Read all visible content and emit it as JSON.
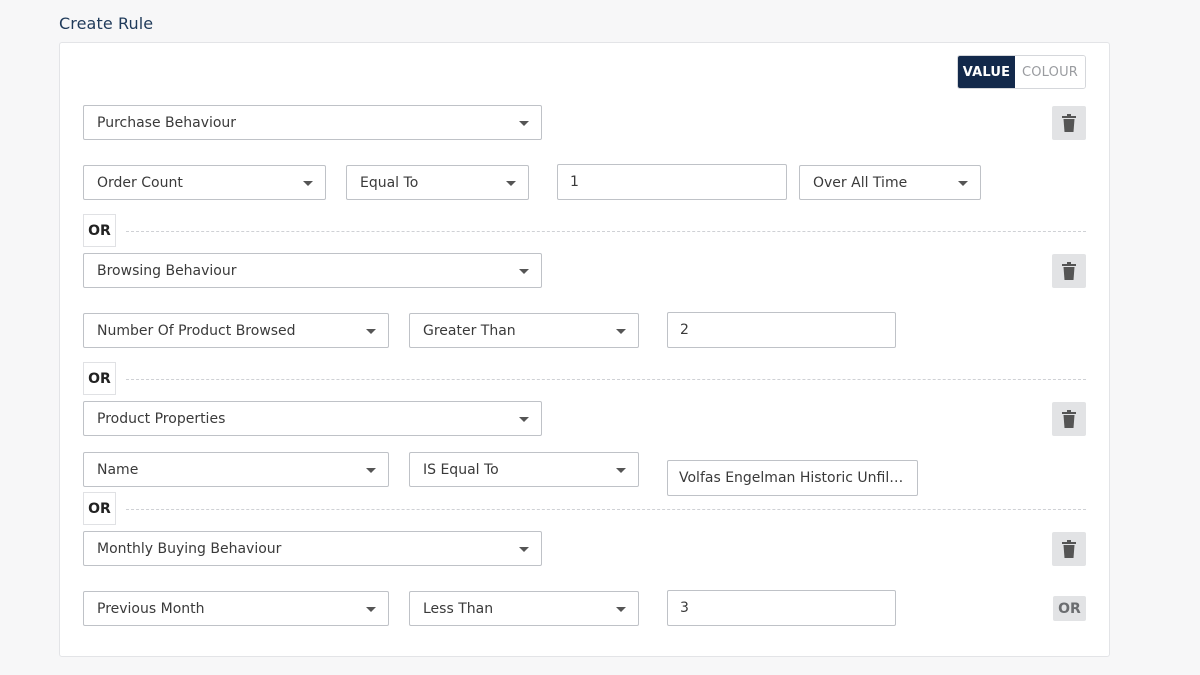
{
  "page": {
    "title": "Create Rule"
  },
  "toggle": {
    "value_label": "VALUE",
    "colour_label": "COLOUR"
  },
  "or_label": "OR",
  "icons": {
    "delete": "trash-icon",
    "dropdown": "caret-down-icon"
  },
  "colors": {
    "accent": "#13294b",
    "title": "#1f3a5a"
  },
  "groups": [
    {
      "category": "Purchase Behaviour",
      "field": "Order Count",
      "operator": "Equal To",
      "value": "1",
      "period": "Over All Time"
    },
    {
      "category": "Browsing Behaviour",
      "field": "Number Of Product Browsed",
      "operator": "Greater Than",
      "value": "2"
    },
    {
      "category": "Product Properties",
      "field": "Name",
      "operator": "IS Equal To",
      "value": "Volfas Engelman Historic Unfiltered"
    },
    {
      "category": "Monthly Buying Behaviour",
      "field": "Previous Month",
      "operator": "Less Than",
      "value": "3"
    }
  ]
}
